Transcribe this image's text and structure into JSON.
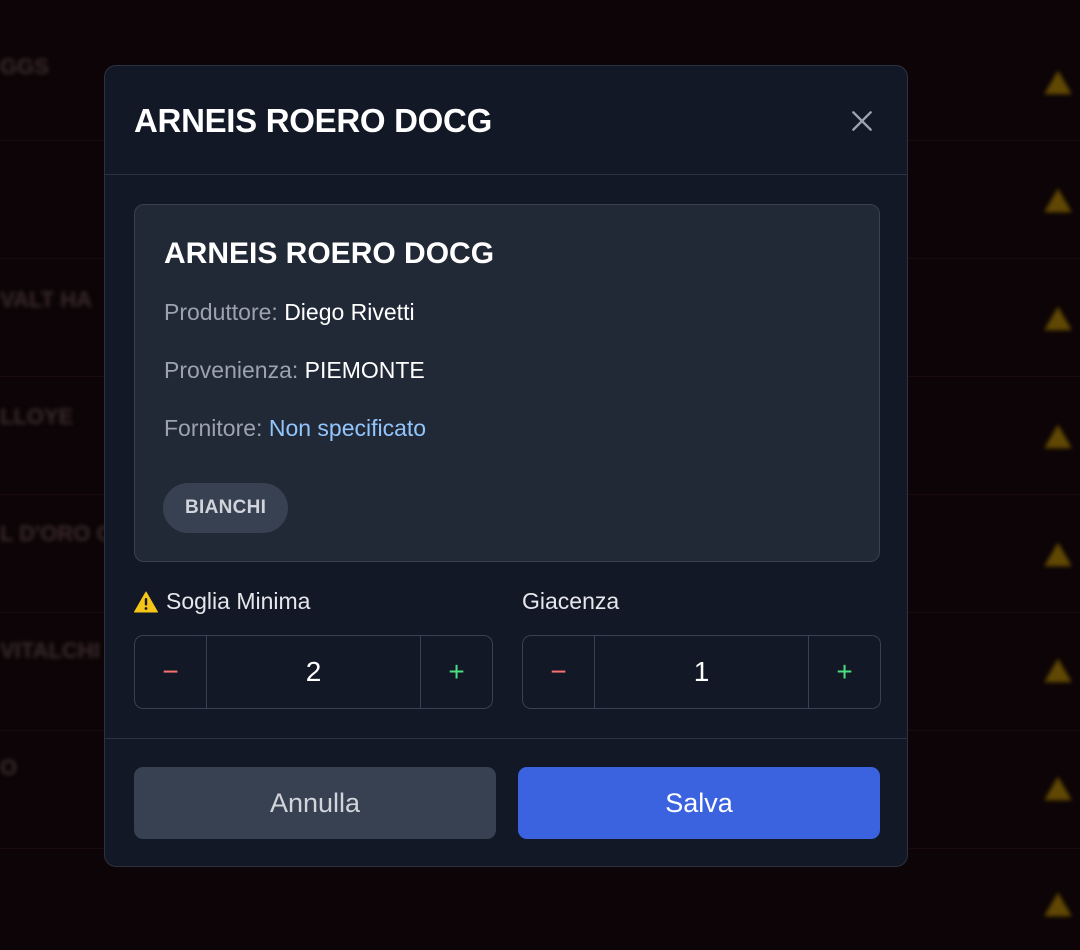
{
  "background": {
    "texts": [
      "GGS",
      "VALT HA",
      "LLOYE",
      "L D'ORO C",
      "VITALCHI",
      "O"
    ]
  },
  "modal": {
    "title": "ARNEIS ROERO DOCG",
    "close_icon": "close-icon",
    "card": {
      "title": "ARNEIS ROERO DOCG",
      "producer_label": "Produttore:",
      "producer_value": "Diego Rivetti",
      "origin_label": "Provenienza:",
      "origin_value": "PIEMONTE",
      "supplier_label": "Fornitore:",
      "supplier_value": "Non specificato",
      "tag": "BIANCHI"
    },
    "min_threshold": {
      "label": "Soglia Minima",
      "icon": "warning-icon",
      "value": "2",
      "minus": "−",
      "plus": "+"
    },
    "stock": {
      "label": "Giacenza",
      "value": "1",
      "minus": "−",
      "plus": "+"
    },
    "cancel_label": "Annulla",
    "save_label": "Salva"
  },
  "colors": {
    "accent": "#3b63e0",
    "minus": "#f87171",
    "plus": "#4ade80",
    "link": "#93c5fd",
    "warning": "#f5c518"
  }
}
